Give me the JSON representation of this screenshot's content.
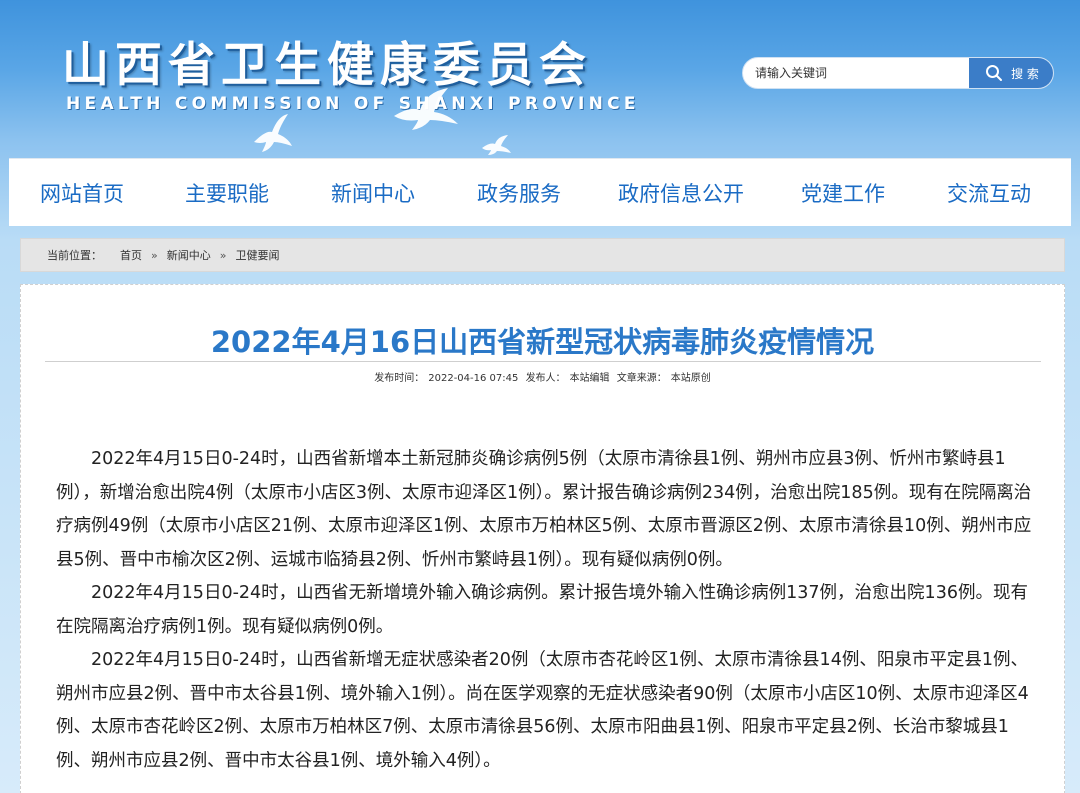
{
  "header": {
    "title": "山西省卫生健康委员会",
    "subtitle": "HEALTH COMMISSION OF SHANXI PROVINCE"
  },
  "search": {
    "placeholder": "请输入关键词",
    "button_label": "搜 索"
  },
  "nav": {
    "items": [
      "网站首页",
      "主要职能",
      "新闻中心",
      "政务服务",
      "政府信息公开",
      "党建工作",
      "交流互动"
    ]
  },
  "breadcrumb": {
    "label": "当前位置：",
    "items": [
      "首页",
      "新闻中心",
      "卫健要闻"
    ],
    "separator": "»"
  },
  "article": {
    "title": "2022年4月16日山西省新型冠状病毒肺炎疫情情况",
    "meta": {
      "publish_label": "发布时间：",
      "publish_time": "2022-04-16 07:45",
      "author_label": "发布人：",
      "author": "本站编辑",
      "source_label": "文章来源：",
      "source": "本站原创"
    },
    "paragraphs": [
      "2022年4月15日0-24时，山西省新增本土新冠肺炎确诊病例5例（太原市清徐县1例、朔州市应县3例、忻州市繁峙县1例），新增治愈出院4例（太原市小店区3例、太原市迎泽区1例）。累计报告确诊病例234例，治愈出院185例。现有在院隔离治疗病例49例（太原市小店区21例、太原市迎泽区1例、太原市万柏林区5例、太原市晋源区2例、太原市清徐县10例、朔州市应县5例、晋中市榆次区2例、运城市临猗县2例、忻州市繁峙县1例）。现有疑似病例0例。",
      "2022年4月15日0-24时，山西省无新增境外输入确诊病例。累计报告境外输入性确诊病例137例，治愈出院136例。现有在院隔离治疗病例1例。现有疑似病例0例。",
      "2022年4月15日0-24时，山西省新增无症状感染者20例（太原市杏花岭区1例、太原市清徐县14例、阳泉市平定县1例、朔州市应县2例、晋中市太谷县1例、境外输入1例）。尚在医学观察的无症状感染者90例（太原市小店区10例、太原市迎泽区4例、太原市杏花岭区2例、太原市万柏林区7例、太原市清徐县56例、太原市阳曲县1例、阳泉市平定县2例、长治市黎城县1例、朔州市应县2例、晋中市太谷县1例、境外输入4例）。"
    ]
  },
  "colors": {
    "nav_text": "#1a6bc4",
    "title_text": "#2a78c8",
    "search_button": "#3b7dc8"
  }
}
